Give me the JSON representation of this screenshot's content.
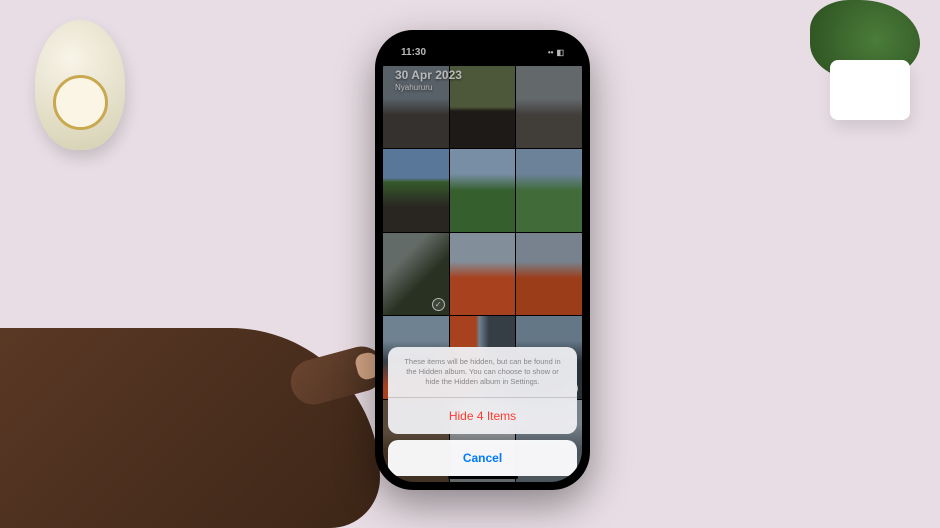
{
  "status": {
    "time": "11:30",
    "signal": "••",
    "battery_glyph": "◧"
  },
  "header": {
    "date": "30 Apr 2023",
    "location": "Nyahururu"
  },
  "action_sheet": {
    "message": "These items will be hidden, but can be found in the Hidden album. You can choose to show or hide the Hidden album in Settings.",
    "destructive_label": "Hide 4 Items",
    "cancel_label": "Cancel"
  },
  "selection_glyph": "✓"
}
